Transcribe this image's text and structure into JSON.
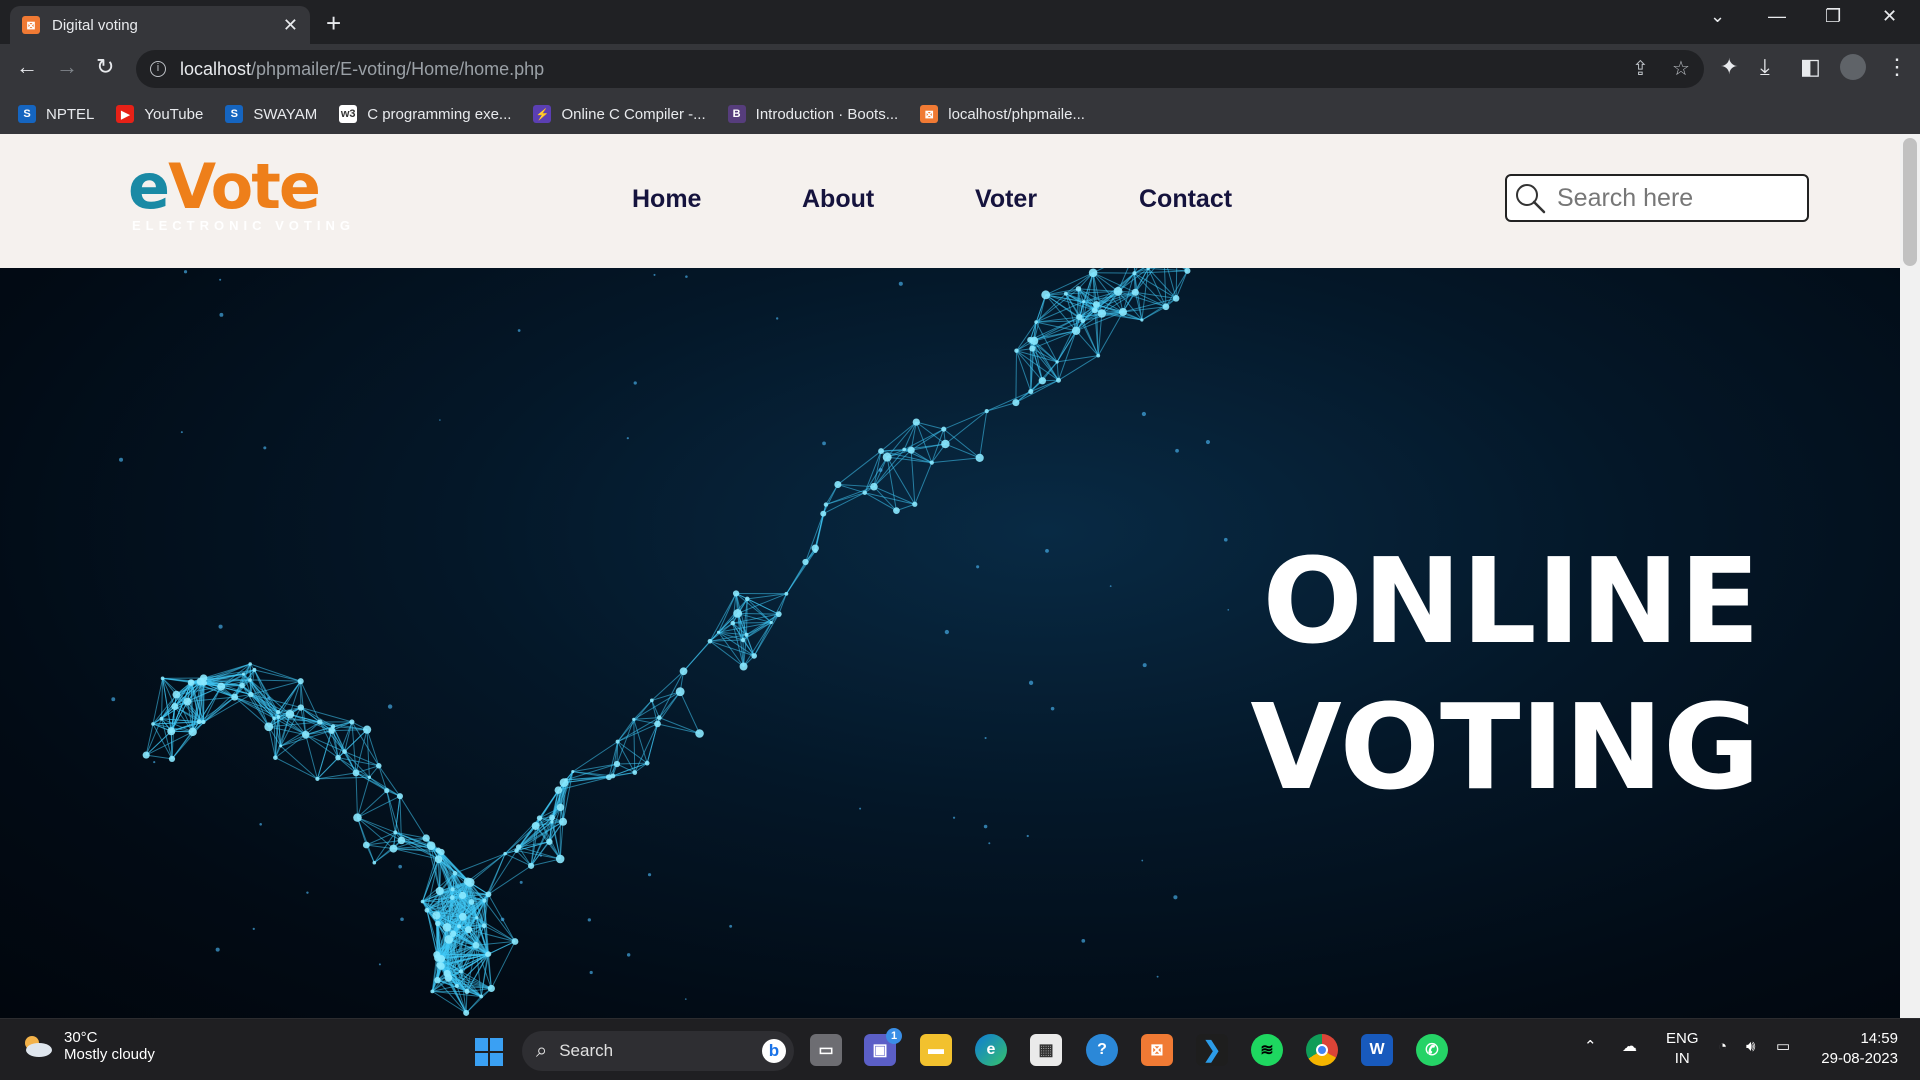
{
  "browser": {
    "tab_title": "Digital voting",
    "url_host": "localhost",
    "url_path": "/phpmailer/E-voting/Home/home.php",
    "bookmarks": [
      {
        "label": "NPTEL",
        "icon": "S",
        "color": "#1565c0"
      },
      {
        "label": "YouTube",
        "icon": "▶",
        "color": "#e62117"
      },
      {
        "label": "SWAYAM",
        "icon": "S",
        "color": "#1565c0"
      },
      {
        "label": "C programming exe...",
        "icon": "w3",
        "color": "#ffffff"
      },
      {
        "label": "Online C Compiler -...",
        "icon": "⚡",
        "color": "#5b3fb3"
      },
      {
        "label": "Introduction · Boots...",
        "icon": "B",
        "color": "#563d7c"
      },
      {
        "label": "localhost/phpmaile...",
        "icon": "⊠",
        "color": "#f07a34"
      }
    ]
  },
  "site": {
    "logo_text_e": "e",
    "logo_text_vote": "Vote",
    "logo_sub": "ELECTRONIC VOTING",
    "nav": [
      "Home",
      "About",
      "Voter",
      "Contact"
    ],
    "search_placeholder": "Search here",
    "hero_line1": "ONLINE",
    "hero_line2": "VOTING"
  },
  "taskbar": {
    "weather_temp": "30°C",
    "weather_desc": "Mostly cloudy",
    "search_label": "Search",
    "lang1": "ENG",
    "lang2": "IN",
    "time": "14:59",
    "date": "29-08-2023",
    "chat_badge": "1"
  },
  "colors": {
    "brand_teal": "#1a8aa5",
    "brand_orange": "#ee7f1a",
    "nav_text": "#15133d",
    "hero_bg": "#041728"
  }
}
